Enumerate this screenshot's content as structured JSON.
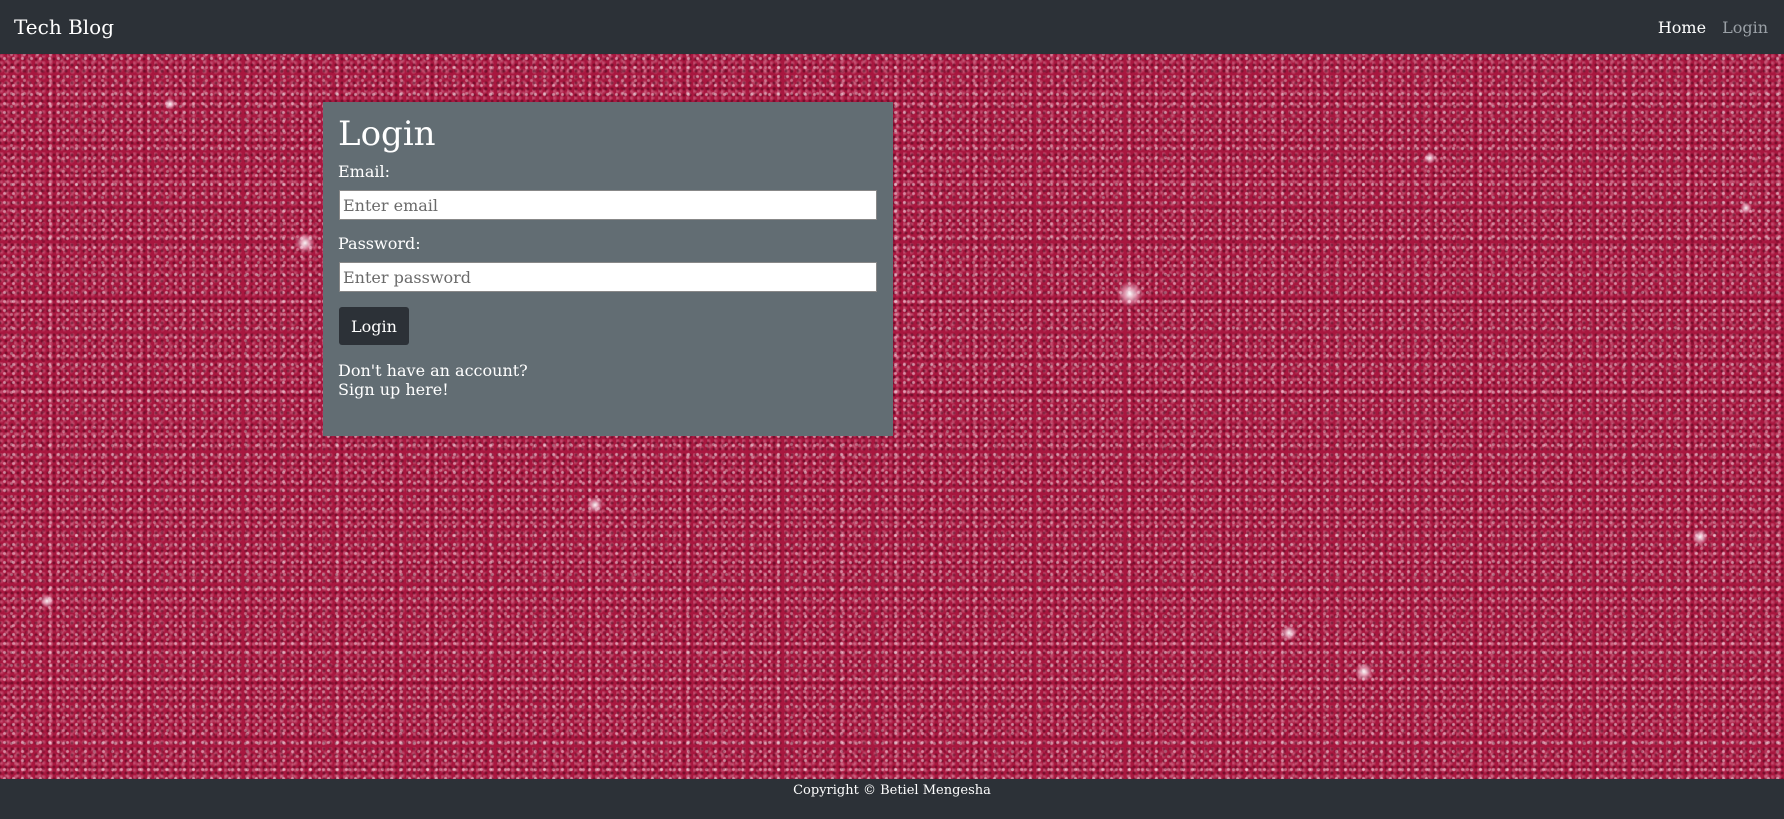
{
  "navbar": {
    "brand": "Tech Blog",
    "links": [
      {
        "label": "Home"
      },
      {
        "label": "Login"
      }
    ]
  },
  "login_form": {
    "title": "Login",
    "email_label": "Email:",
    "email_placeholder": "Enter email",
    "email_value": "",
    "password_label": "Password:",
    "password_placeholder": "Enter password",
    "password_value": "",
    "submit_label": "Login",
    "account_prompt": "Don't have an account?",
    "signup_link": "Sign up here!"
  },
  "footer": {
    "copyright": "Copyright © Betiel Mengesha"
  },
  "colors": {
    "navbar_bg": "#2c3137",
    "card_bg": "#626d73",
    "background": "#a8173f",
    "inactive_link": "#9aa0a6"
  },
  "background_image": "pink glitter texture"
}
